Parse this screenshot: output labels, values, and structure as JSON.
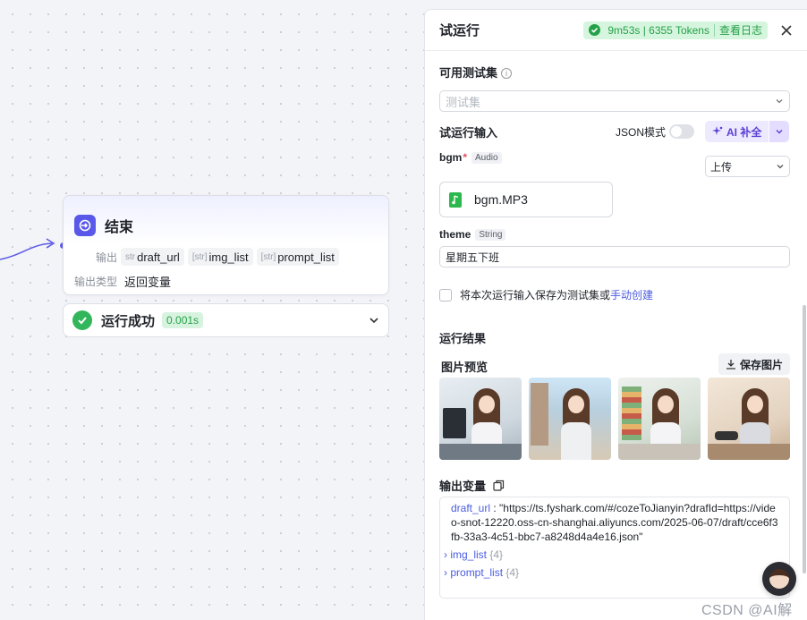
{
  "node": {
    "title": "结束",
    "output_label": "输出",
    "outputs": [
      {
        "type": "str",
        "name": "draft_url"
      },
      {
        "type": "[str]",
        "name": "img_list"
      },
      {
        "type": "[str]",
        "name": "prompt_list"
      }
    ],
    "output_type_label": "输出类型",
    "output_type_value": "返回变量"
  },
  "run_status": {
    "label": "运行成功",
    "time": "0.001s"
  },
  "panel": {
    "title": "试运行",
    "status": {
      "stats": "9m53s | 6355 Tokens",
      "log_link": "查看日志"
    },
    "testset": {
      "label": "可用测试集",
      "placeholder": "测试集"
    },
    "input_section": {
      "label": "试运行输入",
      "json_mode_label": "JSON模式",
      "ai_button": "AI 补全"
    },
    "fields": {
      "bgm": {
        "name": "bgm",
        "type": "Audio",
        "mode": "上传",
        "file_name": "bgm.MP3"
      },
      "theme": {
        "name": "theme",
        "type": "String",
        "value": "星期五下班"
      }
    },
    "save_option": {
      "text": "将本次运行输入保存为测试集或",
      "link": "手动创建"
    },
    "result": {
      "label": "运行结果",
      "preview_label": "图片预览",
      "save_image_button": "保存图片",
      "output_vars_label": "输出变量",
      "draft_url_key": "draft_url",
      "draft_url_value": "\"https://ts.fyshark.com/#/cozeToJianyin?drafId=https://video-snot-12220.oss-cn-shanghai.aliyuncs.com/2025-06-07/draft/cce6f3fb-33a3-4c51-bbc7-a8248d4a4e16.json\"",
      "img_list_key": "img_list",
      "img_list_count": "{4}",
      "prompt_list_key": "prompt_list",
      "prompt_list_count": "{4}"
    }
  },
  "watermark": "CSDN @AI解说",
  "colors": {
    "accent": "#5a58e8",
    "success": "#33b55b",
    "link": "#4a5ce0"
  }
}
